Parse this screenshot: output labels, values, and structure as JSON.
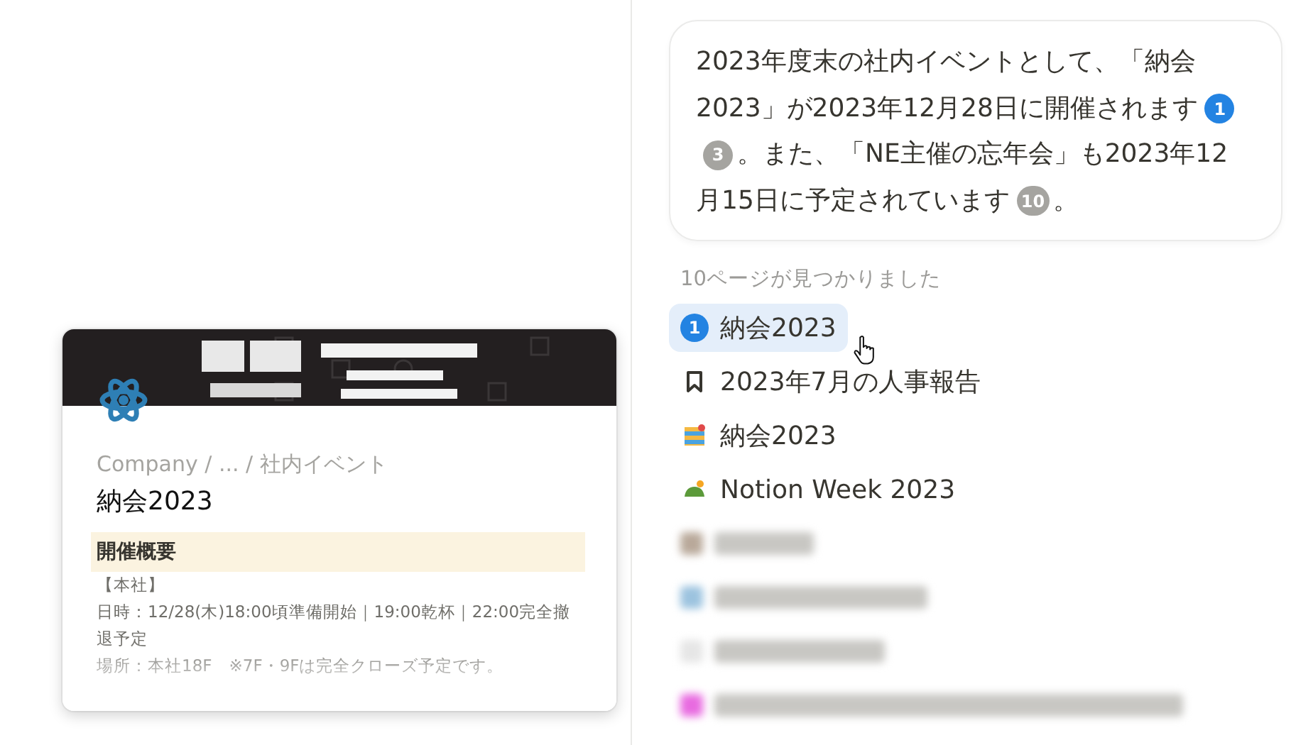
{
  "preview": {
    "breadcrumb": "Company / ... / 社内イベント",
    "title": "納会2023",
    "callout": "開催概要",
    "lines": [
      "【本社】",
      "日時：12/28(木)18:00頃準備開始｜19:00乾杯｜22:00完全撤退予定",
      "場所：本社18F　※7F・9Fは完全クローズ予定です。"
    ]
  },
  "answer": [
    {
      "kind": "text",
      "text": "2023年度末の社内イベントとして、「納会2023」が2023年12月28日に開催されます"
    },
    {
      "kind": "citation",
      "label": "1",
      "selected": true
    },
    {
      "kind": "citation",
      "label": "3",
      "selected": false
    },
    {
      "kind": "text",
      "text": "。また、「NE主催の忘年会」も2023年12月15日に予定されています"
    },
    {
      "kind": "citation",
      "label": "10",
      "selected": false
    },
    {
      "kind": "text",
      "text": "。"
    }
  ],
  "results_label": "10ページが見つかりました",
  "results": [
    {
      "kind": "citation",
      "badge": "1",
      "title": "納会2023",
      "selected": true
    },
    {
      "kind": "bookmark",
      "title": "2023年7月の人事報告",
      "selected": false
    },
    {
      "kind": "calendar",
      "title": "納会2023",
      "selected": false
    },
    {
      "kind": "turtle",
      "title": "Notion Week 2023",
      "selected": false
    },
    {
      "kind": "blurred",
      "color": "#b9a99a"
    },
    {
      "kind": "blurred",
      "color": "#9cc3df"
    },
    {
      "kind": "blurred",
      "color": "#e6e6e6"
    },
    {
      "kind": "blurred",
      "color": "#e86be0"
    }
  ]
}
